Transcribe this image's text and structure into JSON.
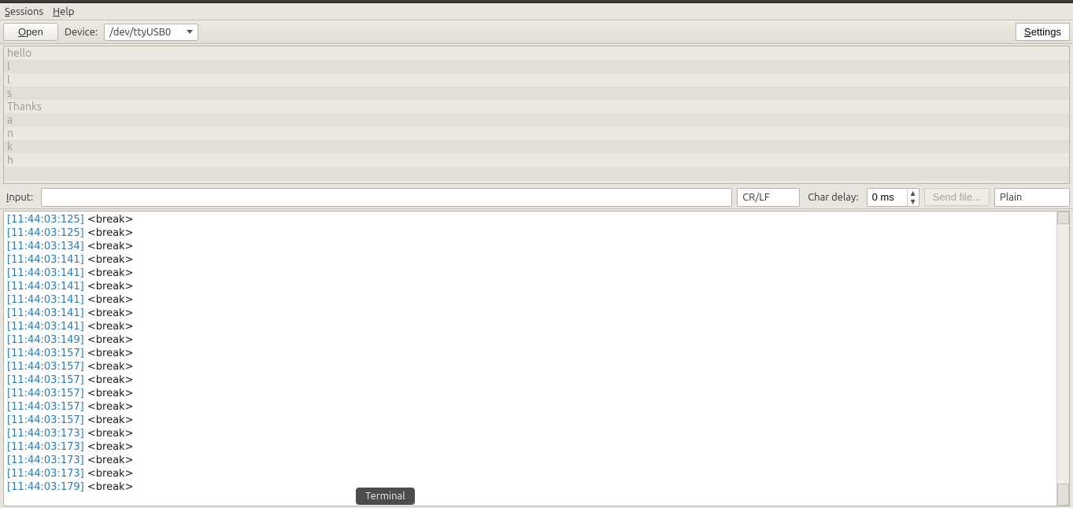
{
  "menubar": {
    "sessions": "Sessions",
    "help": "Help"
  },
  "toolbar": {
    "open_label": "Open",
    "device_label": "Device:",
    "device_value": "/dev/ttyUSB0",
    "settings_label": "Settings"
  },
  "upper_lines": [
    "hello",
    "l",
    "l",
    "s",
    "Thanks",
    "a",
    "n",
    "k",
    "h",
    ""
  ],
  "input_row": {
    "input_label": "Input:",
    "input_value": "",
    "line_ending": "CR/LF",
    "char_delay_label": "Char delay:",
    "char_delay_value": "0 ms",
    "send_file_label": "Send file...",
    "encoding": "Plain"
  },
  "log_lines": [
    {
      "ts": "[11:44:03:125]",
      "msg": "<break>"
    },
    {
      "ts": "[11:44:03:125]",
      "msg": "<break>"
    },
    {
      "ts": "[11:44:03:134]",
      "msg": "<break>"
    },
    {
      "ts": "[11:44:03:141]",
      "msg": "<break>"
    },
    {
      "ts": "[11:44:03:141]",
      "msg": "<break>"
    },
    {
      "ts": "[11:44:03:141]",
      "msg": "<break>"
    },
    {
      "ts": "[11:44:03:141]",
      "msg": "<break>"
    },
    {
      "ts": "[11:44:03:141]",
      "msg": "<break>"
    },
    {
      "ts": "[11:44:03:141]",
      "msg": "<break>"
    },
    {
      "ts": "[11:44:03:149]",
      "msg": "<break>"
    },
    {
      "ts": "[11:44:03:157]",
      "msg": "<break>"
    },
    {
      "ts": "[11:44:03:157]",
      "msg": "<break>"
    },
    {
      "ts": "[11:44:03:157]",
      "msg": "<break>"
    },
    {
      "ts": "[11:44:03:157]",
      "msg": "<break>"
    },
    {
      "ts": "[11:44:03:157]",
      "msg": "<break>"
    },
    {
      "ts": "[11:44:03:157]",
      "msg": "<break>"
    },
    {
      "ts": "[11:44:03:173]",
      "msg": "<break>"
    },
    {
      "ts": "[11:44:03:173]",
      "msg": "<break>"
    },
    {
      "ts": "[11:44:03:173]",
      "msg": "<break>"
    },
    {
      "ts": "[11:44:03:173]",
      "msg": "<break>"
    },
    {
      "ts": "[11:44:03:179]",
      "msg": "<break>"
    }
  ],
  "tooltip": "Terminal"
}
